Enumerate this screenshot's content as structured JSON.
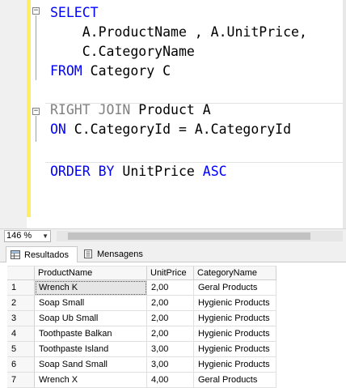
{
  "editor": {
    "lines": [
      [
        {
          "t": "SELECT",
          "c": "kw"
        }
      ],
      [
        {
          "t": "    A.ProductName , A.UnitPrice,",
          "c": ""
        }
      ],
      [
        {
          "t": "    C.CategoryName",
          "c": ""
        }
      ],
      [
        {
          "t": "FROM",
          "c": "kw"
        },
        {
          "t": " Category C",
          "c": ""
        }
      ],
      [],
      [
        {
          "t": "RIGHT JOIN",
          "c": "gr"
        },
        {
          "t": " Product A",
          "c": ""
        }
      ],
      [
        {
          "t": "ON",
          "c": "kw"
        },
        {
          "t": " C.CategoryId = A.CategoryId",
          "c": ""
        }
      ],
      [],
      [
        {
          "t": "ORDER BY",
          "c": "kw"
        },
        {
          "t": " UnitPrice ",
          "c": ""
        },
        {
          "t": "ASC",
          "c": "kw"
        }
      ]
    ]
  },
  "zoom": {
    "value": "146 %"
  },
  "tabs": [
    {
      "label": "Resultados",
      "icon": "grid-icon",
      "active": true
    },
    {
      "label": "Mensagens",
      "icon": "messages-icon",
      "active": false
    }
  ],
  "grid": {
    "columns": [
      "ProductName",
      "UnitPrice",
      "CategoryName"
    ],
    "rows": [
      {
        "n": "1",
        "cells": [
          "Wrench K",
          "2,00",
          "Geral Products"
        ]
      },
      {
        "n": "2",
        "cells": [
          "Soap Small",
          "2,00",
          "Hygienic Products"
        ]
      },
      {
        "n": "3",
        "cells": [
          "Soap Ub Small",
          "2,00",
          "Hygienic Products"
        ]
      },
      {
        "n": "4",
        "cells": [
          "Toothpaste Balkan",
          "2,00",
          "Hygienic Products"
        ]
      },
      {
        "n": "5",
        "cells": [
          "Toothpaste Island",
          "3,00",
          "Hygienic Products"
        ]
      },
      {
        "n": "6",
        "cells": [
          "Soap Sand Small",
          "3,00",
          "Hygienic Products"
        ]
      },
      {
        "n": "7",
        "cells": [
          "Wrench X",
          "4,00",
          "Geral Products"
        ]
      }
    ]
  },
  "colors": {
    "keyword": "#0000ff",
    "changeBar": "#ffee62"
  }
}
